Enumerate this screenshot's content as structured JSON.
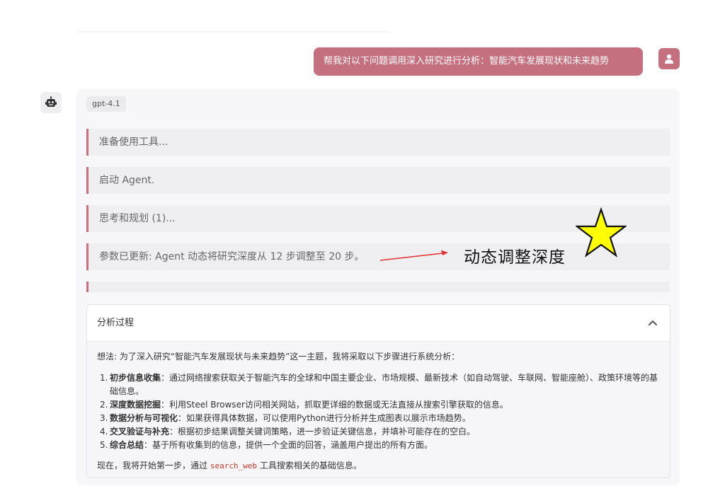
{
  "user_message": "帮我对以下问题调用深入研究进行分析：智能汽车发展现状和未来趋势",
  "icons": {
    "user": "user-icon",
    "bot": "robot-icon",
    "collapse": "chevron-up-icon"
  },
  "colors": {
    "accent": "#c5707e",
    "annotation_star": "#ffff00",
    "annotation_arrow": "#e03030"
  },
  "model_badge": "gpt-4.1",
  "steps": [
    "准备使用工具...",
    "启动 Agent.",
    "思考和规划 (1)...",
    "参数已更新: Agent 动态将研究深度从 12 步调整至 20 步。"
  ],
  "annotation": {
    "text": "动态调整深度"
  },
  "analysis": {
    "title": "分析过程",
    "thought": "想法: 为了深入研究“智能汽车发展现状与未来趋势”这一主题，我将采取以下步骤进行系统分析：",
    "items": [
      {
        "num": "1.",
        "bold": "初步信息收集",
        "text": "：通过网络搜索获取关于智能汽车的全球和中国主要企业、市场规模、最新技术（如自动驾驶、车联网、智能座舱）、政策环境等的基础信息。"
      },
      {
        "num": "2.",
        "bold": "深度数据挖掘",
        "text": "：利用Steel Browser访问相关网站，抓取更详细的数据或无法直接从搜索引擎获取的信息。"
      },
      {
        "num": "3.",
        "bold": "数据分析与可视化",
        "text": "：如果获得具体数据，可以使用Python进行分析并生成图表以展示市场趋势。"
      },
      {
        "num": "4.",
        "bold": "交叉验证与补充",
        "text": "：根据初步结果调整关键词策略，进一步验证关键信息，并填补可能存在的空白。"
      },
      {
        "num": "5.",
        "bold": "综合总结",
        "text": "：基于所有收集到的信息，提供一个全面的回答，涵盖用户提出的所有方面。"
      }
    ],
    "next_prefix": "现在，我将开始第一步，通过 ",
    "next_code": "search_web",
    "next_suffix": " 工具搜索相关的基础信息。"
  }
}
